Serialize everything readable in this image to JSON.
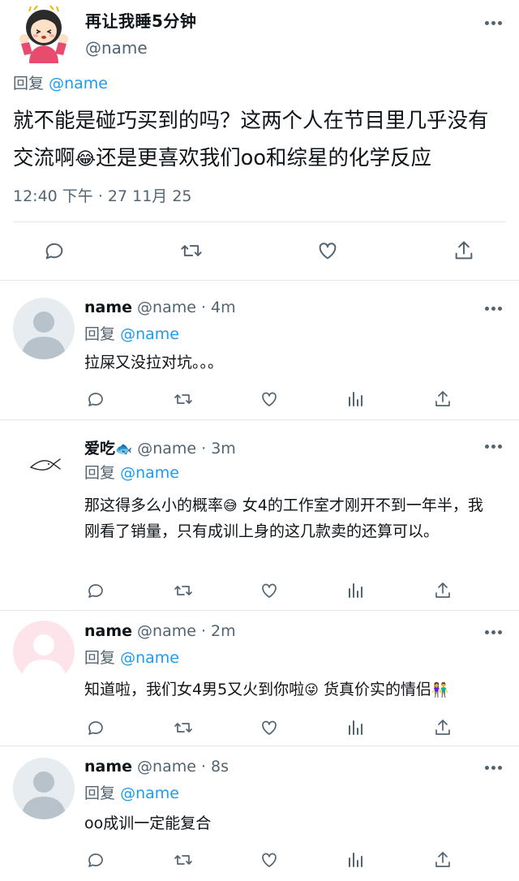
{
  "main_tweet": {
    "author_name": "再让我睡5分钟",
    "author_handle": "@name",
    "reply_prefix": "回复",
    "reply_to": "@name",
    "text_line1": "就不能是碰巧买到的吗？这两个人在节目里几乎没有",
    "text_line2_a": "交流啊",
    "text_emoji": "😂",
    "text_line2_b": "还是更喜欢我们oo和综星的化学反应",
    "timestamp": "12:40 下午 · 27 11月 25",
    "actions": [
      "reply-icon",
      "retweet-icon",
      "like-icon",
      "share-icon"
    ]
  },
  "replies": [
    {
      "name": "name",
      "handle_time": "@name · 4m",
      "reply_prefix": "回复",
      "reply_to": "@name",
      "text": "拉屎又没拉对坑。。。",
      "avatar": "default-gray-avatar"
    },
    {
      "name": "爱吃",
      "name_emoji": "🐟",
      "handle_time": "@name · 3m",
      "reply_prefix": "回复",
      "reply_to": "@name",
      "text_a": "那这得多么小的概率",
      "text_emoji1": "😅",
      "text_b": " 女4的工作室才刚开不到一年半，我刚看了销量，只有成训上身的这几款卖的还算可以。",
      "avatar": "fish-sketch-avatar"
    },
    {
      "name": "name",
      "handle_time": "@name · 2m",
      "reply_prefix": "回复",
      "reply_to": "@name",
      "text_a": "知道啦，我们女4男5又火到你啦",
      "text_emoji1": "😜",
      "text_b": " 货真价实的情侣",
      "text_emoji2": "👫",
      "avatar": "default-pink-avatar"
    },
    {
      "name": "name",
      "handle_time": "@name · 8s",
      "reply_prefix": "回复",
      "reply_to": "@name",
      "text": "oo成训一定能复合",
      "avatar": "default-gray-avatar"
    }
  ],
  "reply_actions": [
    "reply-icon",
    "retweet-icon",
    "like-icon",
    "analytics-icon",
    "share-icon"
  ],
  "colors": {
    "link": "#1d9bf0",
    "secondary": "#536471",
    "divider": "#e1e6ea"
  }
}
